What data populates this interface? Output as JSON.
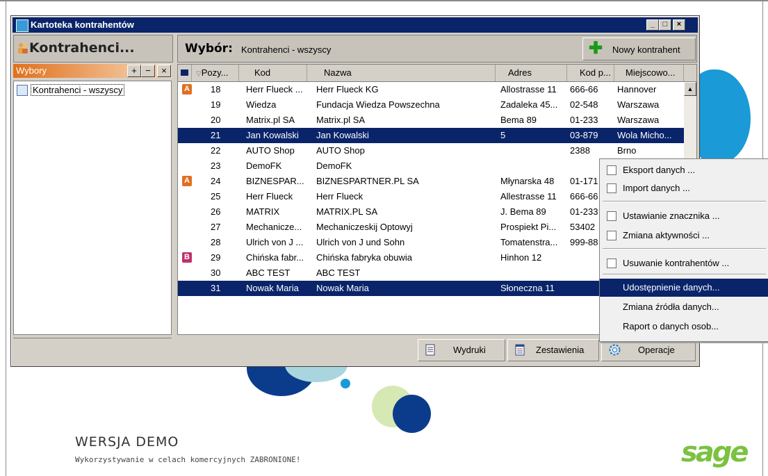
{
  "window": {
    "title": "Kartoteka kontrahentów"
  },
  "left_panel": {
    "header": "Kontrahenci...",
    "wybory_label": "Wybory",
    "buttons": {
      "add": "+",
      "remove": "−",
      "close": "×"
    },
    "items": [
      {
        "label": "Kontrahenci - wszyscy"
      }
    ]
  },
  "main": {
    "wybor_label": "Wybór:",
    "wybor_value": "Kontrahenci - wszyscy",
    "new_button": "Nowy kontrahent",
    "columns": [
      "Pozy...",
      "Kod",
      "Nazwa",
      "Adres",
      "Kod p...",
      "Miejscowo..."
    ],
    "rows": [
      {
        "badge": "A",
        "badge_color": "#e07020",
        "pos": "18",
        "kod": "Herr Flueck ...",
        "nazwa": "Herr Flueck KG",
        "adres": "Allostrasse 11",
        "kodp": "666-66",
        "miejsc": "Hannover"
      },
      {
        "badge": "",
        "badge_color": "",
        "pos": "19",
        "kod": "Wiedza",
        "nazwa": "Fundacja Wiedza Powszechna",
        "adres": "Zadaleka 45...",
        "kodp": "02-548",
        "miejsc": "Warszawa"
      },
      {
        "badge": "",
        "badge_color": "",
        "pos": "20",
        "kod": "Matrix.pl SA",
        "nazwa": "Matrix.pl SA",
        "adres": "Bema 89",
        "kodp": "01-233",
        "miejsc": "Warszawa"
      },
      {
        "badge": "",
        "badge_color": "",
        "pos": "21",
        "kod": "Jan Kowalski",
        "nazwa": "Jan Kowalski",
        "adres": "5",
        "kodp": "03-879",
        "miejsc": "Wola Micho...",
        "selected": true
      },
      {
        "badge": "",
        "badge_color": "",
        "pos": "22",
        "kod": "AUTO Shop",
        "nazwa": "AUTO Shop",
        "adres": "",
        "kodp": "2388",
        "miejsc": "Brno"
      },
      {
        "badge": "",
        "badge_color": "",
        "pos": "23",
        "kod": "DemoFK",
        "nazwa": "DemoFK",
        "adres": "",
        "kodp": "",
        "miejsc": ""
      },
      {
        "badge": "A",
        "badge_color": "#e07020",
        "pos": "24",
        "kod": "BIZNESPAR...",
        "nazwa": "BIZNESPARTNER.PL SA",
        "adres": "Młynarska 48",
        "kodp": "01-171",
        "miejsc": ""
      },
      {
        "badge": "",
        "badge_color": "",
        "pos": "25",
        "kod": "Herr Flueck",
        "nazwa": "Herr Flueck",
        "adres": "Allestrasse 11",
        "kodp": "666-66",
        "miejsc": ""
      },
      {
        "badge": "",
        "badge_color": "",
        "pos": "26",
        "kod": "MATRIX",
        "nazwa": "MATRIX.PL SA",
        "adres": "J. Bema 89",
        "kodp": "01-233",
        "miejsc": ""
      },
      {
        "badge": "",
        "badge_color": "",
        "pos": "27",
        "kod": "Mechanicze...",
        "nazwa": "Mechaniczeskij Optowyj",
        "adres": "Prospiekt Pi...",
        "kodp": "53402",
        "miejsc": ""
      },
      {
        "badge": "",
        "badge_color": "",
        "pos": "28",
        "kod": "Ulrich von J ...",
        "nazwa": "Ulrich von J und Sohn",
        "adres": "Tomatenstra...",
        "kodp": "999-88",
        "miejsc": ""
      },
      {
        "badge": "B",
        "badge_color": "#c0306a",
        "pos": "29",
        "kod": "Chińska fabr...",
        "nazwa": "Chińska fabryka obuwia",
        "adres": "Hinhon 12",
        "kodp": "",
        "miejsc": ""
      },
      {
        "badge": "",
        "badge_color": "",
        "pos": "30",
        "kod": "ABC TEST",
        "nazwa": "ABC TEST",
        "adres": "",
        "kodp": "",
        "miejsc": ""
      },
      {
        "badge": "",
        "badge_color": "",
        "pos": "31",
        "kod": "Nowak Maria",
        "nazwa": "Nowak Maria",
        "adres": "Słoneczna 11",
        "kodp": "",
        "miejsc": "",
        "selected": true
      }
    ]
  },
  "bottom_bar": {
    "wydruki": "Wydruki",
    "zestawienia": "Zestawienia",
    "operacje": "Operacje"
  },
  "context_menu": {
    "items": [
      {
        "label": "Eksport danych ...",
        "checkbox": true
      },
      {
        "label": "Import danych ...",
        "checkbox": true
      },
      {
        "label": "Ustawianie znacznika ...",
        "checkbox": true
      },
      {
        "label": "Zmiana aktywności ...",
        "checkbox": true
      },
      {
        "label": "Usuwanie kontrahentów ...",
        "checkbox": true
      },
      {
        "label": "Udostępnienie danych...",
        "checkbox": false,
        "highlight": true
      },
      {
        "label": "Zmiana źródła danych...",
        "checkbox": false
      },
      {
        "label": "Raport o danych osob...",
        "checkbox": false
      }
    ]
  },
  "watermark": {
    "title": "WERSJA DEMO",
    "subtitle": "Wykorzystywanie w celach komercyjnych ZABRONIONE!",
    "logo": "sage"
  },
  "colors": {
    "selection": "#0a246a",
    "title_bar": "#0a246a",
    "wybory_orange": "#e0701a",
    "logo_green": "#7cc142",
    "deco_blue": "#1a9ad6",
    "deco_navy": "#0b3c8c",
    "deco_teal": "#a9d6de",
    "deco_lime": "#d6e8b4"
  }
}
